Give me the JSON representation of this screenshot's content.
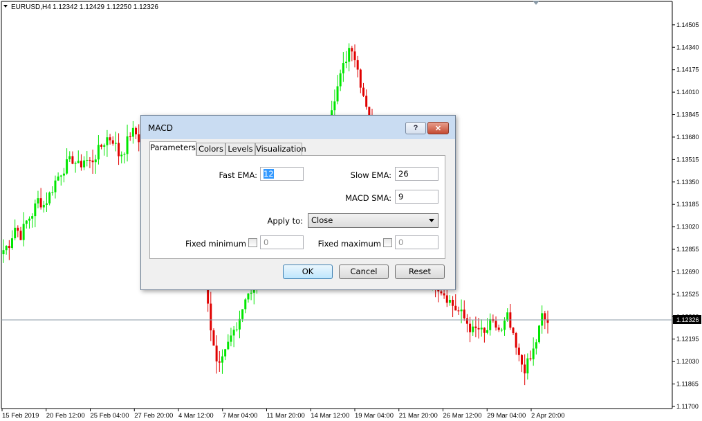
{
  "chart_header": {
    "symbol": "EURUSD,H4",
    "ohlc": "1.12342 1.12429 1.12250 1.12326"
  },
  "price_axis": {
    "labels": [
      "1.14505",
      "1.14340",
      "1.14175",
      "1.14010",
      "1.13845",
      "1.13680",
      "1.13515",
      "1.13350",
      "1.13185",
      "1.13020",
      "1.12855",
      "1.12690",
      "1.12525",
      "1.12360",
      "1.12195",
      "1.12030",
      "1.11865",
      "1.11700"
    ],
    "current_price": "1.12326"
  },
  "time_axis": {
    "labels": [
      "15 Feb 2019",
      "20 Feb 12:00",
      "25 Feb 04:00",
      "27 Feb 20:00",
      "4 Mar 12:00",
      "7 Mar 04:00",
      "11 Mar 20:00",
      "14 Mar 12:00",
      "19 Mar 04:00",
      "21 Mar 20:00",
      "26 Mar 12:00",
      "29 Mar 04:00",
      "2 Apr 20:00"
    ]
  },
  "colors": {
    "bull": "#00e600",
    "bear": "#e00000",
    "accent": "#3399ff"
  },
  "chart_data": {
    "type": "candlestick",
    "price_range": [
      1.117,
      1.1455
    ],
    "close_series": [
      1.1285,
      1.129,
      1.1302,
      1.1296,
      1.1306,
      1.1312,
      1.1322,
      1.1318,
      1.1326,
      1.1336,
      1.1343,
      1.1348,
      1.1352,
      1.1346,
      1.1352,
      1.1349,
      1.1355,
      1.1362,
      1.1368,
      1.1366,
      1.1354,
      1.136,
      1.1372,
      1.137,
      1.1361,
      1.1364,
      1.1362,
      1.136,
      1.1356,
      1.1366,
      1.136,
      1.1352,
      1.1344,
      1.1322,
      1.1294,
      1.1262,
      1.122,
      1.1195,
      1.1205,
      1.1218,
      1.1228,
      1.1238,
      1.1255,
      1.1251,
      1.1262,
      1.1272,
      1.1282,
      1.1291,
      1.13,
      1.1308,
      1.1318,
      1.1334,
      1.1346,
      1.1354,
      1.1364,
      1.1372,
      1.1381,
      1.1396,
      1.1409,
      1.1424,
      1.1438,
      1.1421,
      1.1402,
      1.1388,
      1.137,
      1.1353,
      1.1338,
      1.1322,
      1.1308,
      1.1298,
      1.1289,
      1.1281,
      1.1275,
      1.1269,
      1.1264,
      1.1259,
      1.1254,
      1.1248,
      1.1242,
      1.1238,
      1.1232,
      1.1225,
      1.1227,
      1.1222,
      1.123,
      1.1229,
      1.1224,
      1.1236,
      1.122,
      1.1205,
      1.1198,
      1.1204,
      1.1218,
      1.1236,
      1.1232
    ]
  },
  "dialog": {
    "title": "MACD",
    "help_label": "?",
    "tabs": [
      "Parameters",
      "Colors",
      "Levels",
      "Visualization"
    ],
    "fields": {
      "fast_ema_label": "Fast EMA:",
      "fast_ema_value": "12",
      "slow_ema_label": "Slow EMA:",
      "slow_ema_value": "26",
      "macd_sma_label": "MACD SMA:",
      "macd_sma_value": "9",
      "apply_to_label": "Apply to:",
      "apply_to_value": "Close",
      "fixed_min_label": "Fixed minimum",
      "fixed_min_value": "0",
      "fixed_max_label": "Fixed maximum",
      "fixed_max_value": "0"
    },
    "buttons": {
      "ok": "OK",
      "cancel": "Cancel",
      "reset": "Reset"
    }
  }
}
